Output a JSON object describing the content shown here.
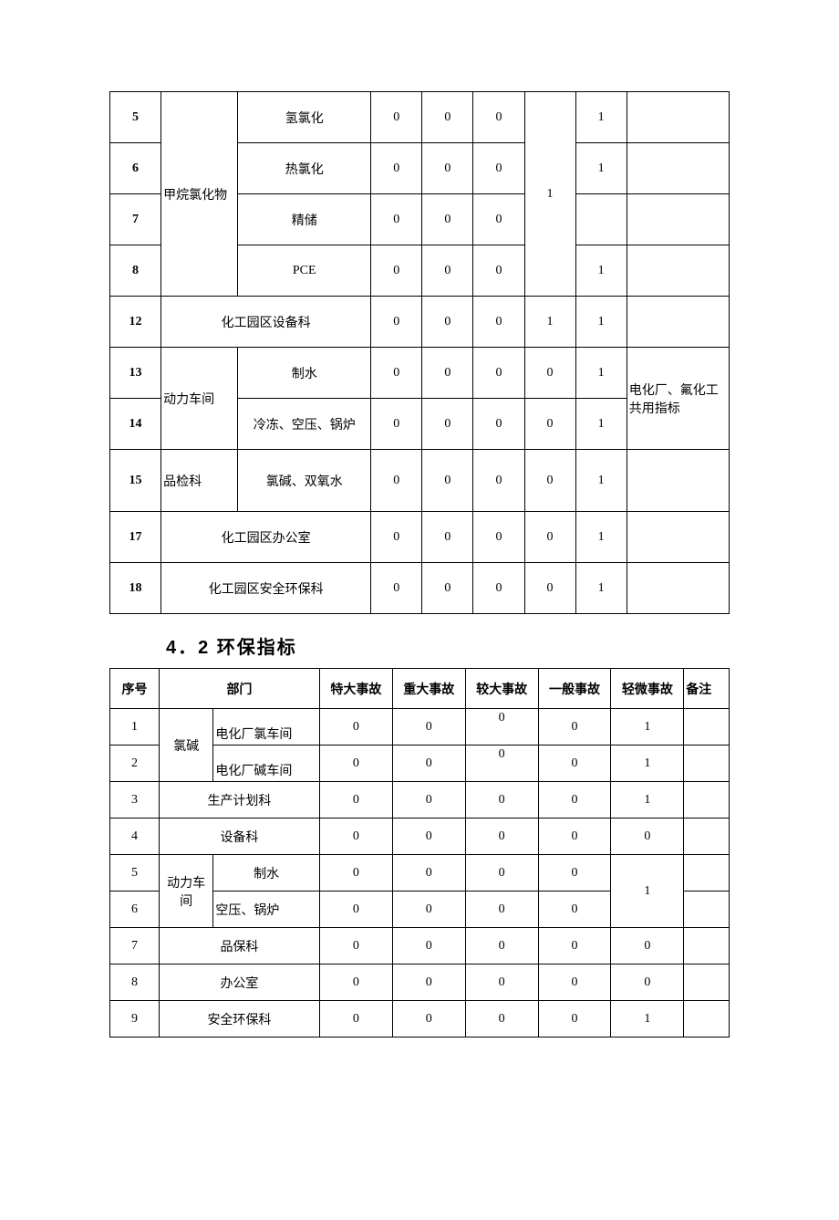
{
  "section_heading": "4．2 环保指标",
  "t1": {
    "merged_dept_5_8": "甲烷氯化物",
    "merged_stat6_5_8": "1",
    "merged_note_13_14": "电化厂、氟化工共用指标",
    "rows": [
      {
        "seq": "5",
        "sub": "氢氯化",
        "c1": "0",
        "c2": "0",
        "c3": "0",
        "c5": "1",
        "note": ""
      },
      {
        "seq": "6",
        "sub": "热氯化",
        "c1": "0",
        "c2": "0",
        "c3": "0",
        "c5": "1",
        "note": ""
      },
      {
        "seq": "7",
        "sub": "精储",
        "c1": "0",
        "c2": "0",
        "c3": "0",
        "c5": "",
        "note": ""
      },
      {
        "seq": "8",
        "sub": "PCE",
        "c1": "0",
        "c2": "0",
        "c3": "0",
        "c5": "1",
        "note": ""
      },
      {
        "seq": "12",
        "dept_span": "化工园区设备科",
        "c1": "0",
        "c2": "0",
        "c3": "0",
        "c4": "1",
        "c5": "1",
        "note": ""
      },
      {
        "seq": "13",
        "dept": "动力车间",
        "sub": "制水",
        "c1": "0",
        "c2": "0",
        "c3": "0",
        "c4": "0",
        "c5": "1"
      },
      {
        "seq": "14",
        "sub": "冷冻、空压、锅炉",
        "c1": "0",
        "c2": "0",
        "c3": "0",
        "c4": "0",
        "c5": "1"
      },
      {
        "seq": "15",
        "dept": "品检科",
        "sub": "氯碱、双氧水",
        "c1": "0",
        "c2": "0",
        "c3": "0",
        "c4": "0",
        "c5": "1",
        "note": ""
      },
      {
        "seq": "17",
        "dept_span": "化工园区办公室",
        "c1": "0",
        "c2": "0",
        "c3": "0",
        "c4": "0",
        "c5": "1",
        "note": ""
      },
      {
        "seq": "18",
        "dept_span": "化工园区安全环保科",
        "c1": "0",
        "c2": "0",
        "c3": "0",
        "c4": "0",
        "c5": "1",
        "note": ""
      }
    ]
  },
  "t2": {
    "headers": {
      "seq": "序号",
      "dept": "部门",
      "c1": "特大事故",
      "c2": "重大事故",
      "c3": "较大事故",
      "c4": "一般事故",
      "c5": "轻微事故",
      "note": "备注"
    },
    "merged_dept_1_2": "氯碱",
    "merged_dept_5_6": "动力车间",
    "merged_c5_5_6": "1",
    "rows": [
      {
        "seq": "1",
        "sub": "电化厂氯车间",
        "c1": "0",
        "c2": "0",
        "c3": "0",
        "c4": "0",
        "c5": "1",
        "note": ""
      },
      {
        "seq": "2",
        "sub": "电化厂碱车间",
        "c1": "0",
        "c2": "0",
        "c3": "0",
        "c4": "0",
        "c5": "1",
        "note": ""
      },
      {
        "seq": "3",
        "dept_span": "生产计划科",
        "c1": "0",
        "c2": "0",
        "c3": "0",
        "c4": "0",
        "c5": "1",
        "note": ""
      },
      {
        "seq": "4",
        "dept_span": "设备科",
        "c1": "0",
        "c2": "0",
        "c3": "0",
        "c4": "0",
        "c5": "0",
        "note": ""
      },
      {
        "seq": "5",
        "sub": "制水",
        "c1": "0",
        "c2": "0",
        "c3": "0",
        "c4": "0",
        "note": ""
      },
      {
        "seq": "6",
        "sub": "空压、锅炉",
        "c1": "0",
        "c2": "0",
        "c3": "0",
        "c4": "0",
        "note": ""
      },
      {
        "seq": "7",
        "dept_span": "品保科",
        "c1": "0",
        "c2": "0",
        "c3": "0",
        "c4": "0",
        "c5": "0",
        "note": ""
      },
      {
        "seq": "8",
        "dept_span": "办公室",
        "c1": "0",
        "c2": "0",
        "c3": "0",
        "c4": "0",
        "c5": "0",
        "note": ""
      },
      {
        "seq": "9",
        "dept_span": "安全环保科",
        "c1": "0",
        "c2": "0",
        "c3": "0",
        "c4": "0",
        "c5": "1",
        "note": ""
      }
    ]
  }
}
